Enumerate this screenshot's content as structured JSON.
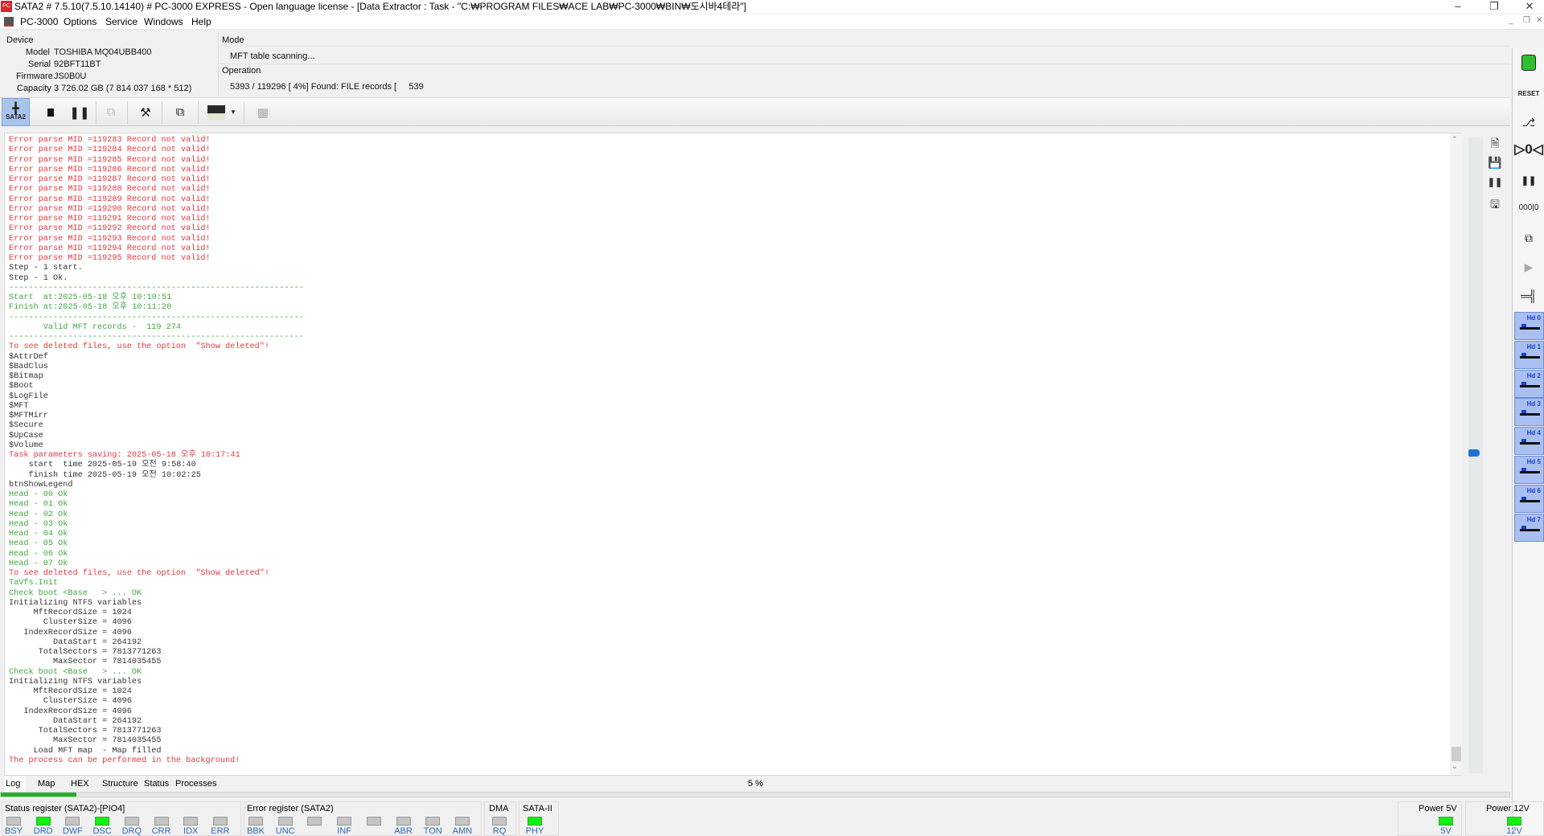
{
  "window": {
    "title": "SATA2 # 7.5.10(7.5.10.14140) # PC-3000 EXPRESS - Open language license - [Data Extractor : Task - \"C:₩PROGRAM FILES₩ACE LAB₩PC-3000₩BIN₩도시바4테라\"]",
    "app_icon_text": "PC"
  },
  "menu": [
    "PC-3000",
    "Options",
    "Service",
    "Windows",
    "Help"
  ],
  "device": {
    "header": "Device",
    "model_label": "Model",
    "model": "TOSHIBA MQ04UBB400",
    "serial_label": "Serial",
    "serial": "92BFT11BT",
    "firmware_label": "Firmware",
    "firmware": "JS0B0U",
    "capacity_label": "Capacity",
    "capacity": "3 726.02 GB (7 814 037 168 * 512)"
  },
  "mode": {
    "header": "Mode",
    "value": "MFT table scanning...",
    "operation_header": "Operation",
    "operation": "5393 / 119296 [ 4%] Found: FILE records [     539"
  },
  "toolbar": {
    "sata2_label": "SATA2"
  },
  "log": [
    {
      "t": "Error parse MID =119283 Record not valid!",
      "c": "r"
    },
    {
      "t": "Error parse MID =119284 Record not valid!",
      "c": "r"
    },
    {
      "t": "Error parse MID =119285 Record not valid!",
      "c": "r"
    },
    {
      "t": "Error parse MID =119286 Record not valid!",
      "c": "r"
    },
    {
      "t": "Error parse MID =119287 Record not valid!",
      "c": "r"
    },
    {
      "t": "Error parse MID =119288 Record not valid!",
      "c": "r"
    },
    {
      "t": "Error parse MID =119289 Record not valid!",
      "c": "r"
    },
    {
      "t": "Error parse MID =119290 Record not valid!",
      "c": "r"
    },
    {
      "t": "Error parse MID =119291 Record not valid!",
      "c": "r"
    },
    {
      "t": "Error parse MID =119292 Record not valid!",
      "c": "r"
    },
    {
      "t": "Error parse MID =119293 Record not valid!",
      "c": "r"
    },
    {
      "t": "Error parse MID =119294 Record not valid!",
      "c": "r"
    },
    {
      "t": "Error parse MID =119295 Record not valid!",
      "c": "r"
    },
    {
      "t": "Step - 1 start.",
      "c": "k"
    },
    {
      "t": "Step - 1 Ok.",
      "c": "k"
    },
    {
      "t": "------------------------------------------------------------",
      "c": "g"
    },
    {
      "t": "Start  at:2025-05-18 오후 10:10:51",
      "c": "g"
    },
    {
      "t": "Finish at:2025-05-18 오후 10:11:20",
      "c": "g"
    },
    {
      "t": "------------------------------------------------------------",
      "c": "g"
    },
    {
      "t": "       Valid MFT records -  119 274",
      "c": "g"
    },
    {
      "t": "------------------------------------------------------------",
      "c": "g"
    },
    {
      "t": "To see deleted files, use the option  \"Show deleted\"!",
      "c": "r"
    },
    {
      "t": "$AttrDef",
      "c": "k"
    },
    {
      "t": "$BadClus",
      "c": "k"
    },
    {
      "t": "$Bitmap",
      "c": "k"
    },
    {
      "t": "$Boot",
      "c": "k"
    },
    {
      "t": "$LogFile",
      "c": "k"
    },
    {
      "t": "$MFT",
      "c": "k"
    },
    {
      "t": "$MFTMirr",
      "c": "k"
    },
    {
      "t": "$Secure",
      "c": "k"
    },
    {
      "t": "$UpCase",
      "c": "k"
    },
    {
      "t": "$Volume",
      "c": "k"
    },
    {
      "t": "Task parameters saving: 2025-05-18 오후 10:17:41",
      "c": "r"
    },
    {
      "t": "    start  time 2025-05-19 오전 9:58:40",
      "c": "k"
    },
    {
      "t": "    finish time 2025-05-19 오전 10:02:25",
      "c": "k"
    },
    {
      "t": "btnShowLegend",
      "c": "k"
    },
    {
      "t": "Head - 00 Ok",
      "c": "g"
    },
    {
      "t": "Head - 01 Ok",
      "c": "g"
    },
    {
      "t": "Head - 02 Ok",
      "c": "g"
    },
    {
      "t": "Head - 03 Ok",
      "c": "g"
    },
    {
      "t": "Head - 04 Ok",
      "c": "g"
    },
    {
      "t": "Head - 05 Ok",
      "c": "g"
    },
    {
      "t": "Head - 06 Ok",
      "c": "g"
    },
    {
      "t": "Head - 07 Ok",
      "c": "g"
    },
    {
      "t": "To see deleted files, use the option  \"Show deleted\"!",
      "c": "r"
    },
    {
      "t": "TaVfs.Init",
      "c": "g"
    },
    {
      "t": "Check boot <Base   > ... OK",
      "c": "g"
    },
    {
      "t": "Initializing NTFS variables",
      "c": "k"
    },
    {
      "t": "     MftRecordSize = 1024",
      "c": "k"
    },
    {
      "t": "       ClusterSize = 4096",
      "c": "k"
    },
    {
      "t": "   IndexRecordSize = 4096",
      "c": "k"
    },
    {
      "t": "         DataStart = 264192",
      "c": "k"
    },
    {
      "t": "      TotalSectors = 7813771263",
      "c": "k"
    },
    {
      "t": "         MaxSector = 7814035455",
      "c": "k"
    },
    {
      "t": "Check boot <Base   > ... OK",
      "c": "g"
    },
    {
      "t": "Initializing NTFS variables",
      "c": "k"
    },
    {
      "t": "     MftRecordSize = 1024",
      "c": "k"
    },
    {
      "t": "       ClusterSize = 4096",
      "c": "k"
    },
    {
      "t": "   IndexRecordSize = 4096",
      "c": "k"
    },
    {
      "t": "         DataStart = 264192",
      "c": "k"
    },
    {
      "t": "      TotalSectors = 7813771263",
      "c": "k"
    },
    {
      "t": "         MaxSector = 7814035455",
      "c": "k"
    },
    {
      "t": "     Load MFT map  - Map filled",
      "c": "k"
    },
    {
      "t": "The process can be performed in the background!",
      "c": "r"
    }
  ],
  "tabs": [
    "Log",
    "Map",
    "HEX",
    "Structure",
    "Status",
    "Processes"
  ],
  "progress": {
    "percent": 5,
    "label": "5 %"
  },
  "heads": [
    "Hd 0",
    "Hd 1",
    "Hd 2",
    "Hd 3",
    "Hd 4",
    "Hd 5",
    "Hd 6",
    "Hd 7"
  ],
  "status_register": {
    "title": "Status register (SATA2)-[PIO4]",
    "leds": [
      {
        "l": "BSY",
        "on": false
      },
      {
        "l": "DRD",
        "on": true
      },
      {
        "l": "DWF",
        "on": false
      },
      {
        "l": "DSC",
        "on": true
      },
      {
        "l": "DRQ",
        "on": false
      },
      {
        "l": "CRR",
        "on": false
      },
      {
        "l": "IDX",
        "on": false
      },
      {
        "l": "ERR",
        "on": false
      }
    ]
  },
  "error_register": {
    "title": "Error register (SATA2)",
    "leds": [
      {
        "l": "BBK",
        "on": false
      },
      {
        "l": "UNC",
        "on": false
      },
      {
        "l": "",
        "on": false
      },
      {
        "l": "INF",
        "on": false
      },
      {
        "l": "",
        "on": false
      },
      {
        "l": "ABR",
        "on": false
      },
      {
        "l": "TON",
        "on": false
      },
      {
        "l": "AMN",
        "on": false
      }
    ]
  },
  "dma": {
    "title": "DMA",
    "leds": [
      {
        "l": "RQ",
        "on": false
      }
    ]
  },
  "sata": {
    "title": "SATA-II",
    "leds": [
      {
        "l": "PHY",
        "on": true
      }
    ]
  },
  "power5": {
    "title": "Power 5V",
    "leds": [
      {
        "l": "5V",
        "on": true
      }
    ]
  },
  "power12": {
    "title": "Power 12V",
    "leds": [
      {
        "l": "12V",
        "on": true
      }
    ]
  },
  "colors": {
    "error": "#e8383d",
    "ok": "#3fa83f",
    "led_on": "#11ee11",
    "accent": "#1a73d6"
  }
}
